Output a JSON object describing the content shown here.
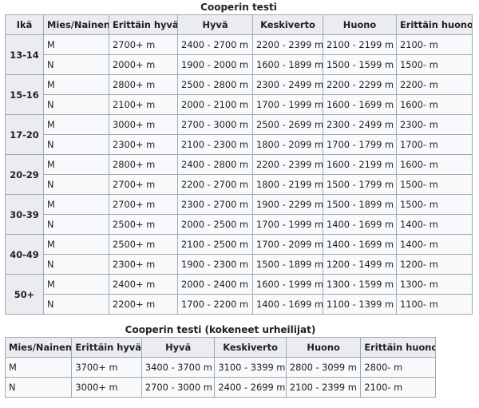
{
  "table1": {
    "caption": "Cooperin testi",
    "headers": [
      "Ikä",
      "Mies/Nainen",
      "Erittäin hyvä",
      "Hyvä",
      "Keskiverto",
      "Huono",
      "Erittäin huono"
    ],
    "groups": [
      {
        "age": "13-14",
        "rows": [
          {
            "sex": "M",
            "cells": [
              "2700+ m",
              "2400 - 2700 m",
              "2200 - 2399 m",
              "2100 - 2199 m",
              "2100- m"
            ]
          },
          {
            "sex": "N",
            "cells": [
              "2000+ m",
              "1900 - 2000 m",
              "1600 - 1899 m",
              "1500 - 1599 m",
              "1500- m"
            ]
          }
        ]
      },
      {
        "age": "15-16",
        "rows": [
          {
            "sex": "M",
            "cells": [
              "2800+ m",
              "2500 - 2800 m",
              "2300 - 2499 m",
              "2200 - 2299 m",
              "2200- m"
            ]
          },
          {
            "sex": "N",
            "cells": [
              "2100+ m",
              "2000 - 2100 m",
              "1700 - 1999 m",
              "1600 - 1699 m",
              "1600- m"
            ]
          }
        ]
      },
      {
        "age": "17-20",
        "rows": [
          {
            "sex": "M",
            "cells": [
              "3000+ m",
              "2700 - 3000 m",
              "2500 - 2699 m",
              "2300 - 2499 m",
              "2300- m"
            ]
          },
          {
            "sex": "N",
            "cells": [
              "2300+ m",
              "2100 - 2300 m",
              "1800 - 2099 m",
              "1700 - 1799 m",
              "1700- m"
            ]
          }
        ]
      },
      {
        "age": "20-29",
        "rows": [
          {
            "sex": "M",
            "cells": [
              "2800+ m",
              "2400 - 2800 m",
              "2200 - 2399 m",
              "1600 - 2199 m",
              "1600- m"
            ]
          },
          {
            "sex": "N",
            "cells": [
              "2700+ m",
              "2200 - 2700 m",
              "1800 - 2199 m",
              "1500 - 1799 m",
              "1500- m"
            ]
          }
        ]
      },
      {
        "age": "30-39",
        "rows": [
          {
            "sex": "M",
            "cells": [
              "2700+ m",
              "2300 - 2700 m",
              "1900 - 2299 m",
              "1500 - 1899 m",
              "1500- m"
            ]
          },
          {
            "sex": "N",
            "cells": [
              "2500+ m",
              "2000 - 2500 m",
              "1700 - 1999 m",
              "1400 - 1699 m",
              "1400- m"
            ]
          }
        ]
      },
      {
        "age": "40-49",
        "rows": [
          {
            "sex": "M",
            "cells": [
              "2500+ m",
              "2100 - 2500 m",
              "1700 - 2099 m",
              "1400 - 1699 m",
              "1400- m"
            ]
          },
          {
            "sex": "N",
            "cells": [
              "2300+ m",
              "1900 - 2300 m",
              "1500 - 1899 m",
              "1200 - 1499 m",
              "1200- m"
            ]
          }
        ]
      },
      {
        "age": "50+",
        "rows": [
          {
            "sex": "M",
            "cells": [
              "2400+ m",
              "2000 - 2400 m",
              "1600 - 1999 m",
              "1300 - 1599 m",
              "1300- m"
            ]
          },
          {
            "sex": "N",
            "cells": [
              "2200+ m",
              "1700 - 2200 m",
              "1400 - 1699 m",
              "1100 - 1399 m",
              "1100- m"
            ]
          }
        ]
      }
    ]
  },
  "table2": {
    "caption": "Cooperin testi (kokeneet urheilijat)",
    "headers": [
      "Mies/Nainen",
      "Erittäin hyvä",
      "Hyvä",
      "Keskiverto",
      "Huono",
      "Erittäin huono"
    ],
    "rows": [
      {
        "sex": "M",
        "cells": [
          "3700+ m",
          "3400 - 3700 m",
          "3100 - 3399 m",
          "2800 - 3099 m",
          "2800- m"
        ]
      },
      {
        "sex": "N",
        "cells": [
          "3000+ m",
          "2700 - 3000 m",
          "2400 - 2699 m",
          "2100 - 2399 m",
          "2100- m"
        ]
      }
    ]
  },
  "colors": {
    "link": "#3366cc",
    "header_bg": "#eaecf0",
    "cell_bg": "#f8f9fa",
    "border": "#a2a9b1"
  }
}
